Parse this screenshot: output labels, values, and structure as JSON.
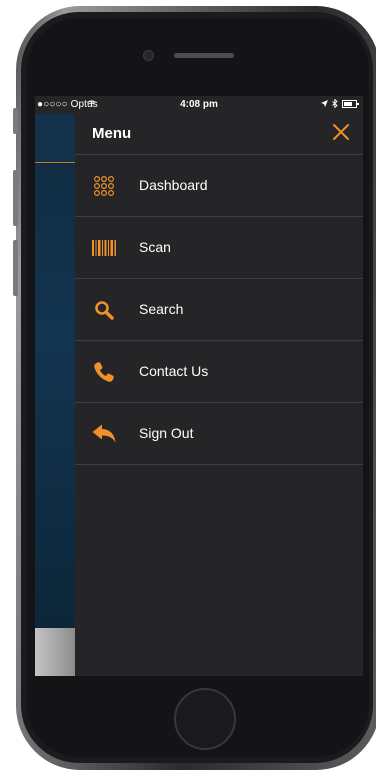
{
  "status_bar": {
    "carrier": "●○○○○ Optus",
    "time": "4:08 pm"
  },
  "menu": {
    "title": "Menu",
    "items": [
      {
        "label": "Dashboard",
        "icon": "grid-dots-icon"
      },
      {
        "label": "Scan",
        "icon": "barcode-icon"
      },
      {
        "label": "Search",
        "icon": "magnifier-icon"
      },
      {
        "label": "Contact Us",
        "icon": "phone-icon"
      },
      {
        "label": "Sign Out",
        "icon": "reply-arrow-icon"
      }
    ]
  },
  "colors": {
    "accent": "#f0902a",
    "drawer_bg": "#252527",
    "divider": "#3e3e42",
    "behind_app": "#123450"
  }
}
